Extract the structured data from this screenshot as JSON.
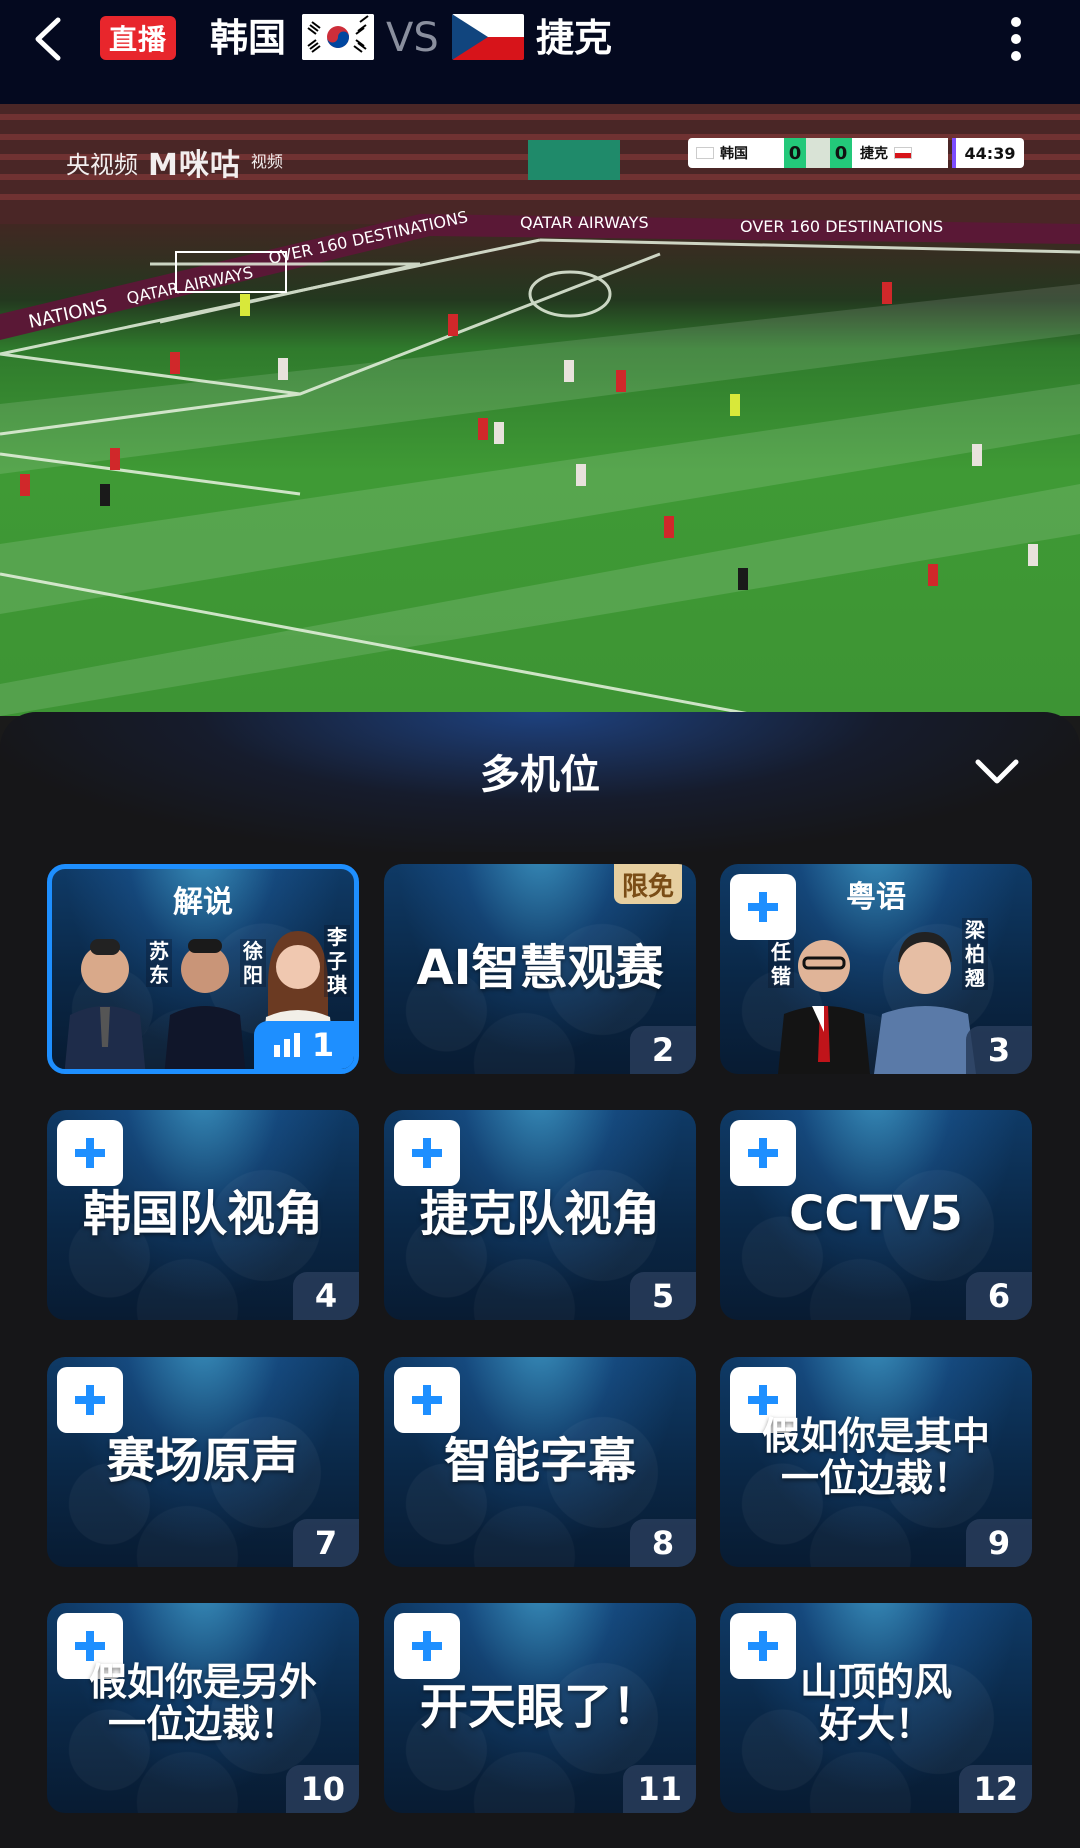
{
  "header": {
    "live_label": "直播",
    "team_a": "韩国",
    "vs_label": "VS",
    "team_b": "捷克"
  },
  "video": {
    "watermark_cctv": "央视频",
    "watermark_migu": "M咪咕",
    "watermark_sub": "视频",
    "scoreboard": {
      "team_a": "韩国",
      "score_a": "0",
      "score_b": "0",
      "team_b": "捷克",
      "time": "44:39"
    },
    "ads": [
      "QATAR AIRWAYS",
      "OVER 160 DESTINATIONS",
      "QATAR AIRWAYS",
      "OVER 160 DESTINATIONS",
      "NATIONS"
    ]
  },
  "sheet": {
    "title": "多机位",
    "cards": [
      {
        "label": "解说",
        "number": "1",
        "active": true,
        "names": [
          "苏东",
          "徐阳",
          "李子琪"
        ]
      },
      {
        "label": "AI智慧观赛",
        "number": "2",
        "tag": "限免"
      },
      {
        "label": "粤语",
        "number": "3",
        "names": [
          "任锴",
          "梁柏翘"
        ]
      },
      {
        "label": "韩国队视角",
        "number": "4"
      },
      {
        "label": "捷克队视角",
        "number": "5"
      },
      {
        "label": "CCTV5",
        "number": "6"
      },
      {
        "label": "赛场原声",
        "number": "7"
      },
      {
        "label": "智能字幕",
        "number": "8"
      },
      {
        "label_line1": "假如你是其中",
        "label_line2": "一位边裁！",
        "number": "9"
      },
      {
        "label_line1": "假如你是另外",
        "label_line2": "一位边裁！",
        "number": "10"
      },
      {
        "label": "开天眼了！",
        "number": "11"
      },
      {
        "label_line1": "山顶的风",
        "label_line2": "好大！",
        "number": "12"
      }
    ]
  },
  "colors": {
    "topbar_bg": "#04091f",
    "live_red": "#e8262c",
    "active_blue": "#1e8fff",
    "free_tag": "#e6cfa0"
  },
  "icons": [
    "back-arrow-icon",
    "more-vertical-icon",
    "collapse-chevron-icon",
    "plus-icon",
    "signal-bars-icon"
  ]
}
